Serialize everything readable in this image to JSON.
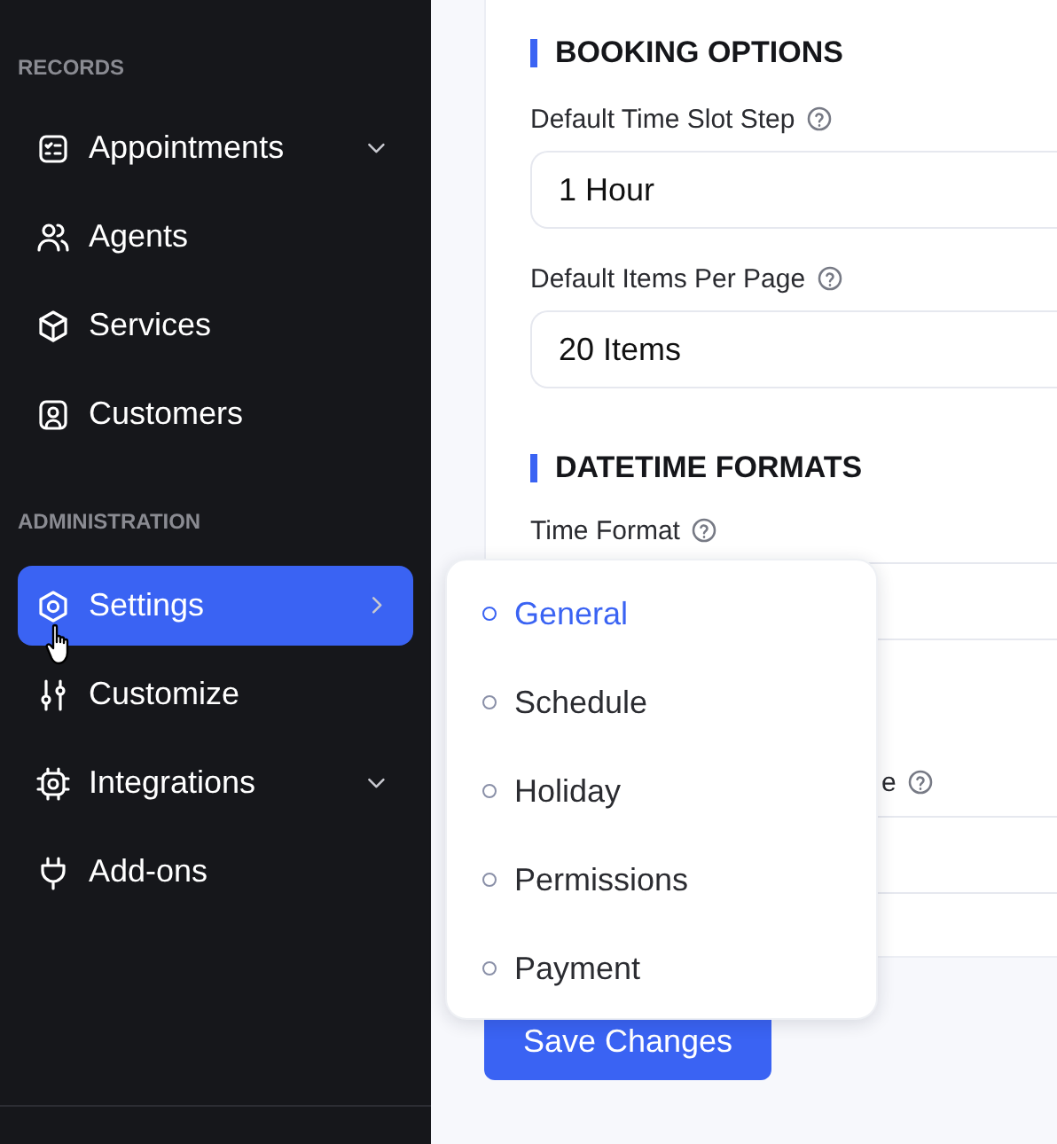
{
  "sidebar": {
    "sections": [
      {
        "title": "RECORDS",
        "items": [
          {
            "label": "Appointments",
            "kind": "expandable",
            "selected": false
          },
          {
            "label": "Agents",
            "kind": "plain",
            "selected": false
          },
          {
            "label": "Services",
            "kind": "plain",
            "selected": false
          },
          {
            "label": "Customers",
            "kind": "plain",
            "selected": false
          }
        ]
      },
      {
        "title": "ADMINISTRATION",
        "items": [
          {
            "label": "Settings",
            "kind": "submenu",
            "selected": true
          },
          {
            "label": "Customize",
            "kind": "plain",
            "selected": false
          },
          {
            "label": "Integrations",
            "kind": "expandable",
            "selected": false
          },
          {
            "label": "Add-ons",
            "kind": "plain",
            "selected": false
          }
        ]
      }
    ]
  },
  "settings": {
    "sections": [
      {
        "title": "BOOKING OPTIONS",
        "fields": [
          {
            "kind": "full",
            "label": "Default Time Slot Step",
            "value": "1 Hour"
          },
          {
            "kind": "full",
            "label": "Default Items Per Page",
            "value": "20 Items"
          }
        ]
      },
      {
        "title": "DATETIME FORMATS",
        "fields": [
          {
            "kind": "full",
            "label": "Time Format"
          },
          {
            "kind": "covered",
            "label": "e"
          }
        ]
      }
    ]
  },
  "save_button": "Save Changes",
  "submenu": {
    "items": [
      {
        "label": "General",
        "selected": true
      },
      {
        "label": "Schedule",
        "selected": false
      },
      {
        "label": "Holiday",
        "selected": false
      },
      {
        "label": "Permissions",
        "selected": false
      },
      {
        "label": "Payment",
        "selected": false
      }
    ]
  }
}
